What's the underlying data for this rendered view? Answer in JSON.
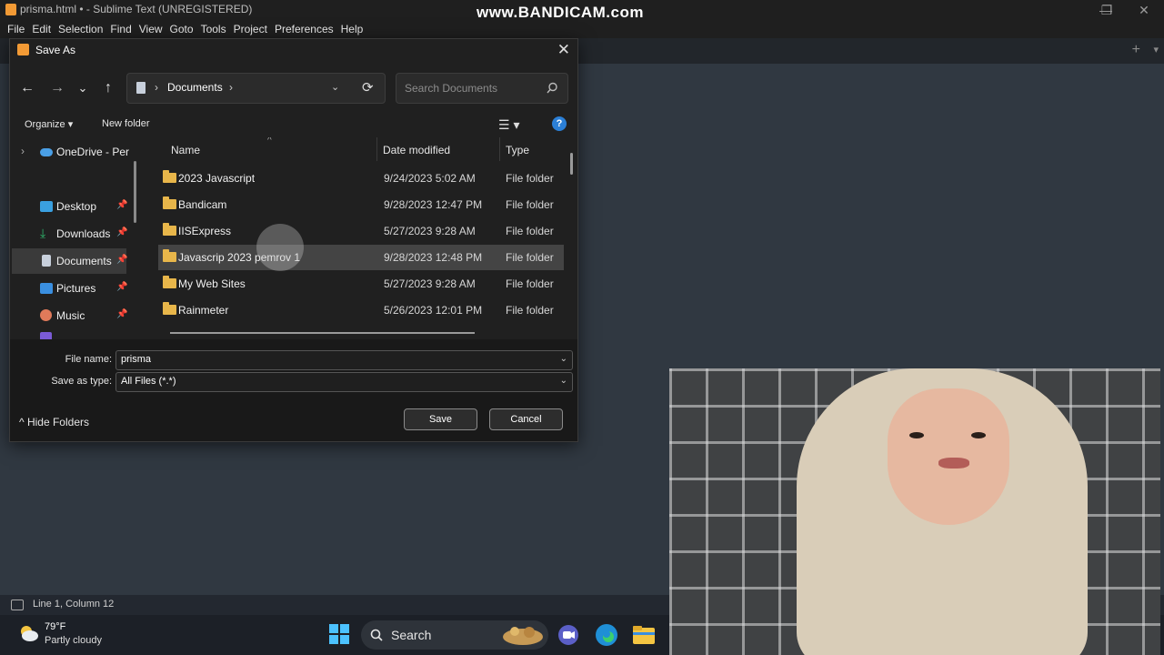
{
  "window": {
    "title": "prisma.html • - Sublime Text (UNREGISTERED)",
    "watermark": "www.BANDICAM.com",
    "controls": [
      "—",
      "❐",
      "✕"
    ]
  },
  "menu": [
    "File",
    "Edit",
    "Selection",
    "Find",
    "View",
    "Goto",
    "Tools",
    "Project",
    "Preferences",
    "Help"
  ],
  "tabs": {
    "add": "+",
    "dropdown": "▾"
  },
  "dialog": {
    "title": "Save As",
    "close": "✕",
    "nav": {
      "back": "←",
      "forward": "→",
      "recent": "⌄",
      "up": "↑"
    },
    "address": {
      "crumb": "Documents",
      "sep": "›",
      "chevron": "⌄",
      "refresh": "⟳"
    },
    "search_placeholder": "Search Documents",
    "toolbar": {
      "organize": "Organize ▾",
      "new_folder": "New folder",
      "view": "☰ ▾",
      "help": "?"
    },
    "nav_pane": [
      {
        "label": "OneDrive - Per",
        "icon": "onedrive-icon",
        "color": "#4a9fe6",
        "pinned": false,
        "expander": "›"
      },
      {
        "label": "Desktop",
        "icon": "desktop-icon",
        "color": "#3aa0e0",
        "pinned": true
      },
      {
        "label": "Downloads",
        "icon": "downloads-icon",
        "color": "#2fb36b",
        "pinned": true
      },
      {
        "label": "Documents",
        "icon": "documents-icon",
        "color": "#c8d0dc",
        "pinned": true,
        "selected": true
      },
      {
        "label": "Pictures",
        "icon": "pictures-icon",
        "color": "#3a8fe0",
        "pinned": true
      },
      {
        "label": "Music",
        "icon": "music-icon",
        "color": "#e07a5a",
        "pinned": true
      }
    ],
    "pin_glyph": "📌",
    "columns": {
      "name": "Name",
      "date": "Date modified",
      "type": "Type",
      "sort_arrow": "^"
    },
    "files": [
      {
        "name": "2023 Javascript",
        "date": "9/24/2023 5:02 AM",
        "type": "File folder"
      },
      {
        "name": "Bandicam",
        "date": "9/28/2023 12:47 PM",
        "type": "File folder"
      },
      {
        "name": "IISExpress",
        "date": "5/27/2023 9:28 AM",
        "type": "File folder"
      },
      {
        "name": "Javascrip 2023 pemrov 1",
        "date": "9/28/2023 12:48 PM",
        "type": "File folder",
        "selected": true
      },
      {
        "name": "My Web Sites",
        "date": "5/27/2023 9:28 AM",
        "type": "File folder"
      },
      {
        "name": "Rainmeter",
        "date": "5/26/2023 12:01 PM",
        "type": "File folder"
      }
    ],
    "form": {
      "file_name_label": "File name:",
      "file_name_value": "prisma",
      "save_type_label": "Save as type:",
      "save_type_value": "All Files (*.*)",
      "hide_folders": "^  Hide Folders",
      "save": "Save",
      "cancel": "Cancel"
    }
  },
  "status": {
    "text": "Line 1, Column 12"
  },
  "taskbar": {
    "temp": "79°F",
    "condition": "Partly cloudy",
    "search": "Search"
  }
}
